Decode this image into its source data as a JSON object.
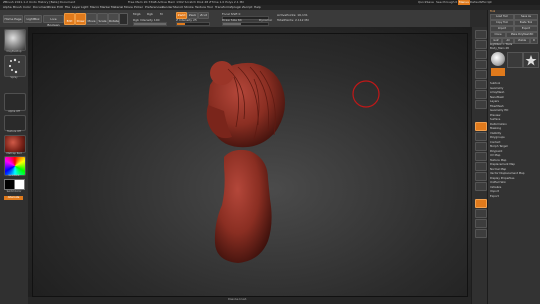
{
  "window": {
    "title": "ZBrush 2021.1.2 Undo History [Beta] Document",
    "mem_info": "Free Mem 20.73GB  Active Mem 1302  Scratch Disk 48  ZTime 1.0  Polys 2.1 Mil"
  },
  "top_right": {
    "quicksave": "QuickSave",
    "see_through": "See-through 0",
    "menus": "Menus",
    "default_script": "DefaultZScript"
  },
  "menubar": {
    "items": [
      "Alpha",
      "Brush",
      "Color",
      "Document",
      "Draw",
      "Edit",
      "File",
      "Layer",
      "Light",
      "Macro",
      "Marker",
      "Material",
      "Movie",
      "Picker",
      "Preferences",
      "Render",
      "Stencil",
      "Stroke",
      "Texture",
      "Tool",
      "Transform",
      "Zplugin",
      "Zscript",
      "Help"
    ]
  },
  "toolbar": {
    "home_page": "Home Page",
    "lightbox": "LightBox",
    "live_boolean": "Live Boolean",
    "edit": "Edit",
    "draw": "Draw",
    "move": "Move",
    "scale": "Scale",
    "rotate": "Rotate",
    "mrgb": "Mrgb",
    "rgb": "Rgb",
    "m": "M",
    "zadd": "Zadd",
    "zsub": "Zsub",
    "zcut": "Zcut",
    "focal_shift": "Focal Shift 0",
    "draw_size": "Draw Size 64",
    "dynamic": "Dynamic",
    "rgb_intensity": "Rgb Intensity 100",
    "z_intensity": "Z Intensity 25",
    "active_points": "ActivePoints: 16,131",
    "total_points": "TotalPoints: 2.112 Mil",
    "z_intensity_level": 0.25,
    "rgb_intensity_level": 1.0,
    "draw_size_level": 0.4
  },
  "leftshelf": {
    "brush_label": "ClayBuildup",
    "stroke_label": "Spray",
    "alpha_label": "Alpha Off",
    "texture_label": "Texture Off",
    "material_label": "MatCap Red",
    "gradient_label": "Gradient",
    "switch_color": "SwitchColor",
    "alternate": "Alternate"
  },
  "tray": {
    "title": "Tool",
    "load_tool": "Load Tool",
    "save_as": "Save As",
    "copy_tool": "Copy Tool",
    "paste_tool": "Paste Tool",
    "import": "Import",
    "export": "Export",
    "clone": "Clone",
    "make_polymesh": "Make PolyMesh3D",
    "goz": "GoZ",
    "all": "All",
    "visible": "Visible",
    "r": "R",
    "lightbox_tools": "Lightbox > Tools",
    "current_tool": "Body_Main 48",
    "items": [
      "Subtool",
      "Geometry",
      "ArrayMesh",
      "NanoMesh",
      "Layers",
      "FiberMesh",
      "Geometry HD",
      "Preview",
      "Surface",
      "Deformation",
      "Masking",
      "Visibility",
      "Polygroups",
      "Contact",
      "Morph Target",
      "Polypaint",
      "UV Map",
      "Texture Map",
      "Displacement Map",
      "Normal Map",
      "Vector Displacement Map",
      "Display Properties",
      "Unified Skin",
      "Initialize",
      "Import",
      "Export"
    ]
  },
  "statusbar": {
    "text": "Dissolve brush"
  },
  "colors": {
    "accent": "#e07a1c",
    "clay": "#8a2e22"
  }
}
